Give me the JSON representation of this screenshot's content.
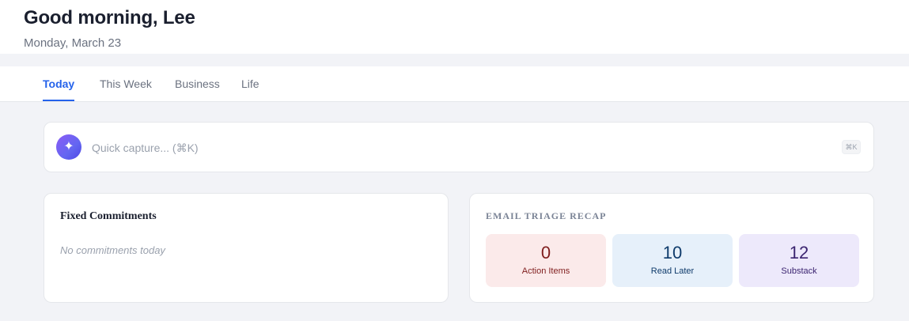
{
  "header": {
    "greeting": "Good morning, Lee",
    "date": "Monday, March 23"
  },
  "tabs": [
    {
      "label": "Today",
      "active": true
    },
    {
      "label": "This Week",
      "active": false
    },
    {
      "label": "Business",
      "active": false
    },
    {
      "label": "Life",
      "active": false
    }
  ],
  "capture": {
    "icon": "sparkle-icon",
    "placeholder": "Quick capture... (⌘K)",
    "shortcut": "⌘K"
  },
  "commitments": {
    "title": "Fixed Commitments",
    "empty": "No commitments today"
  },
  "email_recap": {
    "title": "EMAIL TRIAGE RECAP",
    "tiles": [
      {
        "value": "0",
        "label": "Action Items",
        "color": "#7f1d1d",
        "bg": "#fbeaea"
      },
      {
        "value": "10",
        "label": "Read Later",
        "color": "#0f3b6b",
        "bg": "#e6f0fa"
      },
      {
        "value": "12",
        "label": "Substack",
        "color": "#3b2470",
        "bg": "#ede9fb"
      }
    ]
  },
  "colors": {
    "accent": "#2563eb",
    "background": "#f2f3f7"
  }
}
